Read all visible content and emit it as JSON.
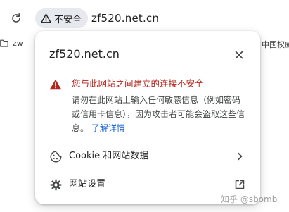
{
  "toolbar": {
    "reload_icon": "reload-icon",
    "security_chip": {
      "icon": "warning-triangle-icon",
      "label": "不安全"
    },
    "url": "zf520.net.cn"
  },
  "bookmarks": {
    "left_label": "zw",
    "right_label": "中国权威"
  },
  "popup": {
    "title": "zf520.net.cn",
    "close_icon": "close-icon",
    "warning": {
      "icon": "warning-triangle-icon",
      "color": "#b3261e",
      "title": "您与此网站之间建立的连接不安全",
      "body": "请勿在此网站上输入任何敏感信息（例如密码或信用卡信息），因为攻击者可能会盗取这些信息。",
      "link": "了解详情",
      "link_color": "#0b57d0"
    },
    "rows": [
      {
        "icon": "cookie-icon",
        "label": "Cookie 和网站数据",
        "trail_icon": "chevron-right-icon"
      },
      {
        "icon": "gear-icon",
        "label": "网站设置",
        "trail_icon": "open-external-icon"
      }
    ]
  },
  "watermark": "知乎 @sbomb"
}
